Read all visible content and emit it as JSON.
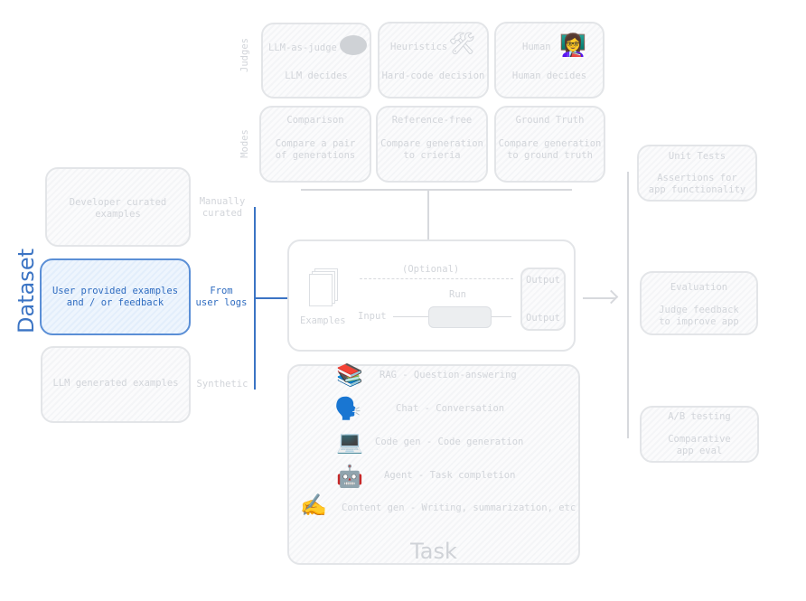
{
  "judges": {
    "label": "Judges",
    "items": [
      {
        "title": "LLM-as-judge",
        "desc": "LLM decides",
        "icon": "brain-icon"
      },
      {
        "title": "Heuristics",
        "desc": "Hard-code decision",
        "icon": "hammer-wrench-icon"
      },
      {
        "title": "Human",
        "desc": "Human decides",
        "icon": "teacher-icon"
      }
    ]
  },
  "modes": {
    "label": "Modes",
    "items": [
      {
        "title": "Comparison",
        "desc": "Compare a pair\nof generations"
      },
      {
        "title": "Reference-free",
        "desc": "Compare generation\nto crieria"
      },
      {
        "title": "Ground Truth",
        "desc": "Compare generation\nto ground truth"
      }
    ]
  },
  "dataset": {
    "title": "Dataset",
    "items": [
      {
        "text": "Developer curated\nexamples",
        "label": "Manually\ncurated"
      },
      {
        "text": "User provided examples\nand / or feedback",
        "label": "From\nuser logs"
      },
      {
        "text": "LLM generated examples",
        "label": "Synthetic"
      }
    ]
  },
  "run": {
    "examples": "Examples",
    "optional": "(Optional)",
    "input": "Input",
    "run": "Run",
    "output1": "Output",
    "output2": "Output"
  },
  "task": {
    "title": "Task",
    "items": [
      {
        "text": "RAG - Question-answering",
        "emoji": "📚"
      },
      {
        "text": "Chat - Conversation",
        "emoji": "🗣️"
      },
      {
        "text": "Code gen - Code generation",
        "emoji": "💻"
      },
      {
        "text": "Agent - Task completion",
        "emoji": "🤖"
      },
      {
        "text": "Content gen - Writing, summarization, etc",
        "emoji": "✍️"
      }
    ]
  },
  "results": [
    {
      "title": "Unit Tests",
      "desc": "Assertions for\napp functionality"
    },
    {
      "title": "Evaluation",
      "desc": "Judge feedback\nto improve app"
    },
    {
      "title": "A/B testing",
      "desc": "Comparative\napp eval"
    }
  ],
  "colors": {
    "accent": "#3b74c4",
    "muted": "#d2d5da"
  }
}
